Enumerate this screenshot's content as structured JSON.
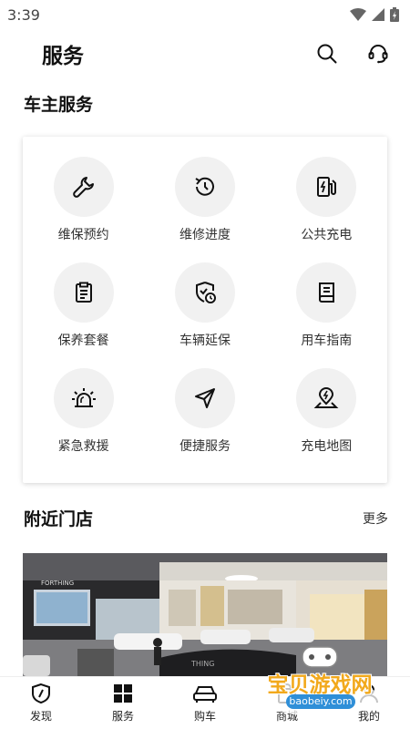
{
  "status_bar": {
    "time": "3:39",
    "icons": [
      "wifi-icon",
      "signal-icon",
      "battery-icon"
    ]
  },
  "header": {
    "title": "服务",
    "icons": [
      "search-icon",
      "headset-icon"
    ]
  },
  "owner_services": {
    "title": "车主服务",
    "items": [
      {
        "label": "维保预约",
        "icon": "wrench-icon"
      },
      {
        "label": "维修进度",
        "icon": "history-icon"
      },
      {
        "label": "公共充电",
        "icon": "charging-station-icon"
      },
      {
        "label": "保养套餐",
        "icon": "clipboard-icon"
      },
      {
        "label": "车辆延保",
        "icon": "shield-clock-icon"
      },
      {
        "label": "用车指南",
        "icon": "book-icon"
      },
      {
        "label": "紧急救援",
        "icon": "alarm-light-icon"
      },
      {
        "label": "便捷服务",
        "icon": "send-icon"
      },
      {
        "label": "充电地图",
        "icon": "map-pin-bolt-icon"
      }
    ]
  },
  "nearby": {
    "title": "附近门店",
    "more": "更多",
    "image_sign_left": "FORTHING",
    "image_sign_desk": "THING"
  },
  "tabs": [
    {
      "label": "发现",
      "icon": "shield-icon"
    },
    {
      "label": "服务",
      "icon": "grid-icon"
    },
    {
      "label": "购车",
      "icon": "car-icon"
    },
    {
      "label": "商城",
      "icon": "bag-icon"
    },
    {
      "label": "我的",
      "icon": "user-icon"
    }
  ],
  "watermark": {
    "text": "宝贝游戏网",
    "url": "baobeiy.com"
  },
  "colors": {
    "accent": "#111111",
    "icon_bg": "#f1f1f1",
    "watermark": "#f2a91c"
  }
}
